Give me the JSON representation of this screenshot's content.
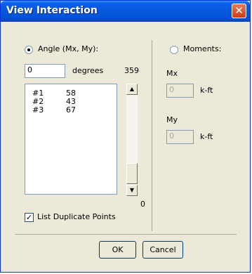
{
  "window": {
    "title": "View Interaction",
    "close_glyph": "✕"
  },
  "angle": {
    "label": "Angle (Mx, My):",
    "selected": true,
    "input_value": "0",
    "unit": "degrees",
    "max_value": "359",
    "min_value": "0",
    "list": [
      {
        "id": "#1",
        "value": "58"
      },
      {
        "id": "#2",
        "value": "43"
      },
      {
        "id": "#3",
        "value": "67"
      }
    ],
    "list_duplicates_label": "List Duplicate Points",
    "list_duplicates_checked": true
  },
  "moments": {
    "label": "Moments:",
    "selected": false,
    "mx_label": "Mx",
    "mx_value": "0",
    "my_label": "My",
    "my_value": "0",
    "unit": "k-ft"
  },
  "buttons": {
    "ok": "OK",
    "cancel": "Cancel"
  },
  "icons": {
    "close": "close-icon",
    "scroll_up": "scroll-up-icon",
    "scroll_down": "scroll-down-icon",
    "check": "check-icon"
  }
}
